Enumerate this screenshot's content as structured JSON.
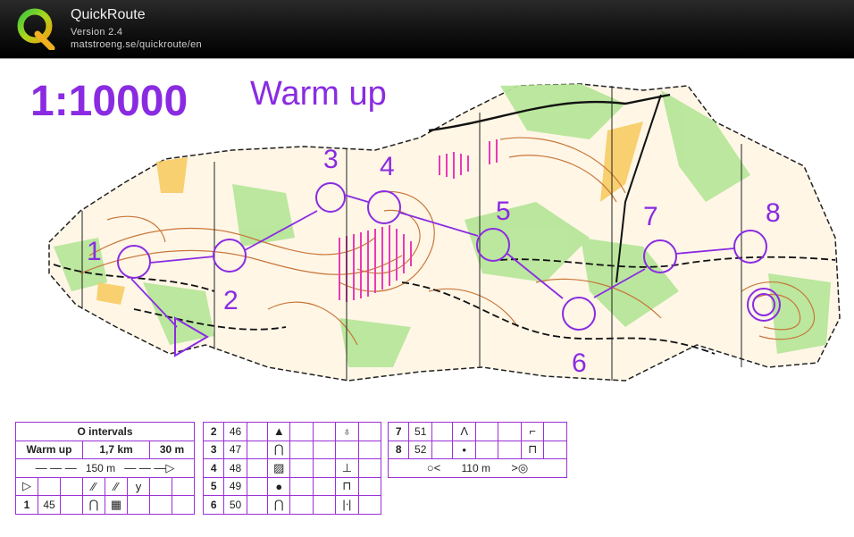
{
  "app": {
    "title": "QuickRoute",
    "version": "Version 2.4",
    "url": "matstroeng.se/quickroute/en"
  },
  "map": {
    "scale": "1:10000",
    "course_title": "Warm up",
    "controls": [
      {
        "number": "1"
      },
      {
        "number": "2"
      },
      {
        "number": "3"
      },
      {
        "number": "4"
      },
      {
        "number": "5"
      },
      {
        "number": "6"
      },
      {
        "number": "7"
      },
      {
        "number": "8"
      }
    ]
  },
  "description_sheet": {
    "header": "O intervals",
    "course_name": "Warm up",
    "course_length": "1,7 km",
    "climb": "30 m",
    "start_marked_route": "150 m",
    "finish_distance": "110 m",
    "rows": [
      {
        "no": "1",
        "code": "45"
      },
      {
        "no": "2",
        "code": "46"
      },
      {
        "no": "3",
        "code": "47"
      },
      {
        "no": "4",
        "code": "48"
      },
      {
        "no": "5",
        "code": "49"
      },
      {
        "no": "6",
        "code": "50"
      },
      {
        "no": "7",
        "code": "51"
      },
      {
        "no": "8",
        "code": "52"
      }
    ]
  },
  "colors": {
    "course": "#8a2be2",
    "map_open": "#ffffff",
    "map_forest_green": "#a9e28a",
    "map_yellow": "#f8c451",
    "map_contours": "#c8773a"
  }
}
